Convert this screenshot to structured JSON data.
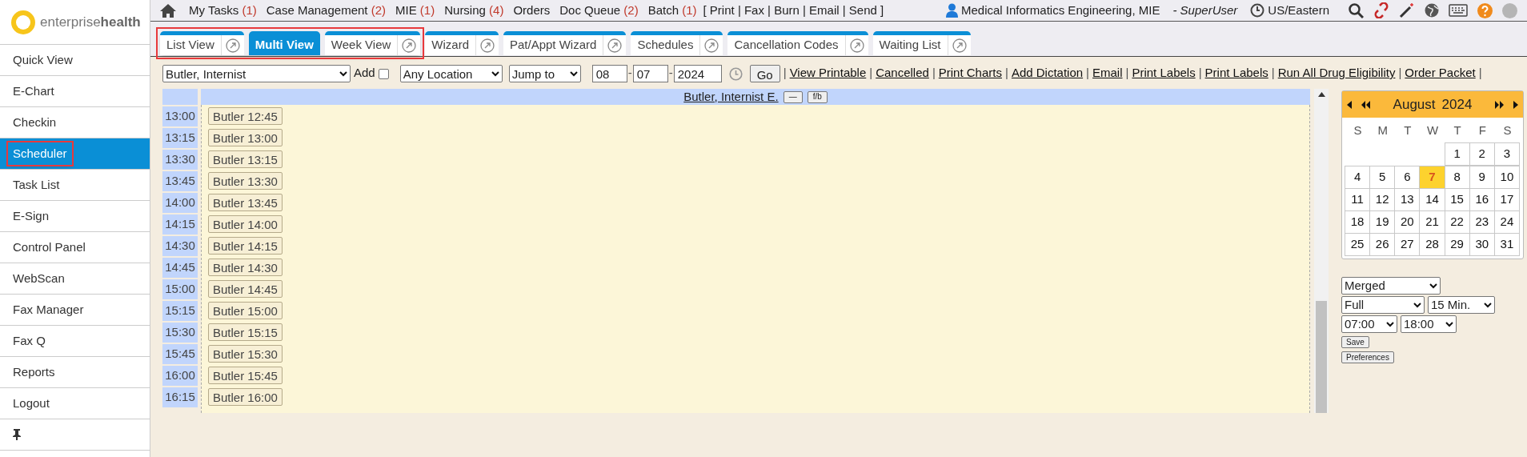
{
  "logo": {
    "text_light": "enterprise",
    "text_bold": "health"
  },
  "topbar": {
    "nav_items": [
      {
        "label": "My Tasks",
        "count": "(1)"
      },
      {
        "label": "Case Management",
        "count": "(2)"
      },
      {
        "label": "MIE",
        "count": "(1)"
      },
      {
        "label": "Nursing",
        "count": "(4)"
      },
      {
        "label": "Orders"
      },
      {
        "label": "Doc Queue",
        "count": "(2)"
      },
      {
        "label": "Batch",
        "count": "(1)"
      }
    ],
    "actions": "[ Print | Fax | Burn | Email | Send ]",
    "user": "Medical Informatics Engineering, MIE",
    "role": "- SuperUser",
    "timezone": "US/Eastern"
  },
  "tabs": [
    {
      "label": "List View",
      "selected": false,
      "highlighted": true
    },
    {
      "label": "Multi View",
      "selected": true,
      "highlighted": true
    },
    {
      "label": "Week View",
      "selected": false,
      "highlighted": true
    },
    {
      "label": "Wizard",
      "selected": false,
      "highlighted": false
    },
    {
      "label": "Pat/Appt Wizard",
      "selected": false,
      "highlighted": false
    },
    {
      "label": "Schedules",
      "selected": false,
      "highlighted": false
    },
    {
      "label": "Cancellation Codes",
      "selected": false,
      "highlighted": false
    },
    {
      "label": "Waiting List",
      "selected": false,
      "highlighted": false
    }
  ],
  "sidebar": {
    "items": [
      {
        "label": "Quick View",
        "selected": false,
        "highlighted": false
      },
      {
        "label": "E-Chart",
        "selected": false,
        "highlighted": false
      },
      {
        "label": "Checkin",
        "selected": false,
        "highlighted": false
      },
      {
        "label": "Scheduler",
        "selected": true,
        "highlighted": true
      },
      {
        "label": "Task List",
        "selected": false,
        "highlighted": false
      },
      {
        "label": "E-Sign",
        "selected": false,
        "highlighted": false
      },
      {
        "label": "Control Panel",
        "selected": false,
        "highlighted": false
      },
      {
        "label": "WebScan",
        "selected": false,
        "highlighted": false
      },
      {
        "label": "Fax Manager",
        "selected": false,
        "highlighted": false
      },
      {
        "label": "Fax Q",
        "selected": false,
        "highlighted": false
      },
      {
        "label": "Reports",
        "selected": false,
        "highlighted": false
      },
      {
        "label": "Logout",
        "selected": false,
        "highlighted": false
      }
    ]
  },
  "toolbar": {
    "provider": "Butler, Internist",
    "add_label": "Add",
    "add_checked": false,
    "location": "Any Location",
    "jump": "Jump to",
    "month": "08",
    "day": "07",
    "year": "2024",
    "go": "Go",
    "date_separator": "-",
    "link_separator": "|",
    "links": [
      "View Printable",
      "Cancelled",
      "Print Charts",
      "Add Dictation",
      "Email",
      "Print Labels",
      "Print Labels",
      "Run All Drug Eligibility",
      "Order Packet"
    ]
  },
  "schedule": {
    "provider": "Butler, Internist E.",
    "collapse_button": "—",
    "fb_button": "f/b",
    "rows": [
      {
        "time": "13:00",
        "slot": "Butler 12:45"
      },
      {
        "time": "13:15",
        "slot": "Butler 13:00"
      },
      {
        "time": "13:30",
        "slot": "Butler 13:15"
      },
      {
        "time": "13:45",
        "slot": "Butler 13:30"
      },
      {
        "time": "14:00",
        "slot": "Butler 13:45"
      },
      {
        "time": "14:15",
        "slot": "Butler 14:00"
      },
      {
        "time": "14:30",
        "slot": "Butler 14:15"
      },
      {
        "time": "14:45",
        "slot": "Butler 14:30"
      },
      {
        "time": "15:00",
        "slot": "Butler 14:45"
      },
      {
        "time": "15:15",
        "slot": "Butler 15:00"
      },
      {
        "time": "15:30",
        "slot": "Butler 15:15"
      },
      {
        "time": "15:45",
        "slot": "Butler 15:30"
      },
      {
        "time": "16:00",
        "slot": "Butler 15:45"
      },
      {
        "time": "16:15",
        "slot": "Butler 16:00"
      }
    ]
  },
  "calendar": {
    "month": "August",
    "year": "2024",
    "weekdays": [
      "S",
      "M",
      "T",
      "W",
      "T",
      "F",
      "S"
    ],
    "weeks": [
      [
        {
          "kind": "blank"
        },
        {
          "kind": "blank"
        },
        {
          "kind": "blank"
        },
        {
          "kind": "blank"
        },
        {
          "label": "1",
          "selected": false
        },
        {
          "label": "2",
          "selected": false
        },
        {
          "label": "3",
          "selected": false
        }
      ],
      [
        {
          "label": "4",
          "selected": false
        },
        {
          "label": "5",
          "selected": false
        },
        {
          "label": "6",
          "selected": false
        },
        {
          "label": "7",
          "selected": true
        },
        {
          "label": "8",
          "selected": false
        },
        {
          "label": "9",
          "selected": false
        },
        {
          "label": "10",
          "selected": false
        }
      ],
      [
        {
          "label": "11",
          "selected": false
        },
        {
          "label": "12",
          "selected": false
        },
        {
          "label": "13",
          "selected": false
        },
        {
          "label": "14",
          "selected": false
        },
        {
          "label": "15",
          "selected": false
        },
        {
          "label": "16",
          "selected": false
        },
        {
          "label": "17",
          "selected": false
        }
      ],
      [
        {
          "label": "18",
          "selected": false
        },
        {
          "label": "19",
          "selected": false
        },
        {
          "label": "20",
          "selected": false
        },
        {
          "label": "21",
          "selected": false
        },
        {
          "label": "22",
          "selected": false
        },
        {
          "label": "23",
          "selected": false
        },
        {
          "label": "24",
          "selected": false
        }
      ],
      [
        {
          "label": "25",
          "selected": false
        },
        {
          "label": "26",
          "selected": false
        },
        {
          "label": "27",
          "selected": false
        },
        {
          "label": "28",
          "selected": false
        },
        {
          "label": "29",
          "selected": false
        },
        {
          "label": "30",
          "selected": false
        },
        {
          "label": "31",
          "selected": false
        }
      ]
    ]
  },
  "view_settings": {
    "mode": "Merged",
    "range": "Full",
    "interval": "15 Min.",
    "start": "07:00",
    "end": "18:00",
    "save": "Save",
    "preferences": "Preferences"
  }
}
